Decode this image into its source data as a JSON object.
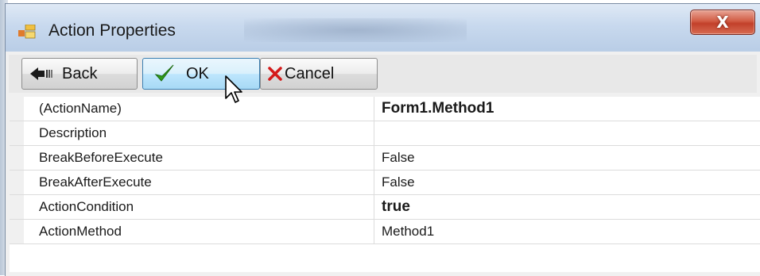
{
  "window": {
    "title": "Action Properties",
    "close_glyph": "X"
  },
  "toolbar": {
    "back_label": "Back",
    "ok_label": "OK",
    "cancel_label": "Cancel"
  },
  "icons": {
    "app": "properties-app-icon",
    "back": "back-arrow-icon",
    "ok": "green-check-icon",
    "cancel": "red-x-icon",
    "cursor": "mouse-pointer-icon"
  },
  "colors": {
    "ok_check": "#2e9b1a",
    "cancel_x": "#d41a1a",
    "close_button": "#c2402a"
  },
  "properties": [
    {
      "name": "(ActionName)",
      "value": "Form1.Method1",
      "bold": true
    },
    {
      "name": "Description",
      "value": "",
      "bold": false
    },
    {
      "name": "BreakBeforeExecute",
      "value": "False",
      "bold": false
    },
    {
      "name": "BreakAfterExecute",
      "value": "False",
      "bold": false
    },
    {
      "name": "ActionCondition",
      "value": "true",
      "bold": true
    },
    {
      "name": "ActionMethod",
      "value": "Method1",
      "bold": false
    }
  ]
}
